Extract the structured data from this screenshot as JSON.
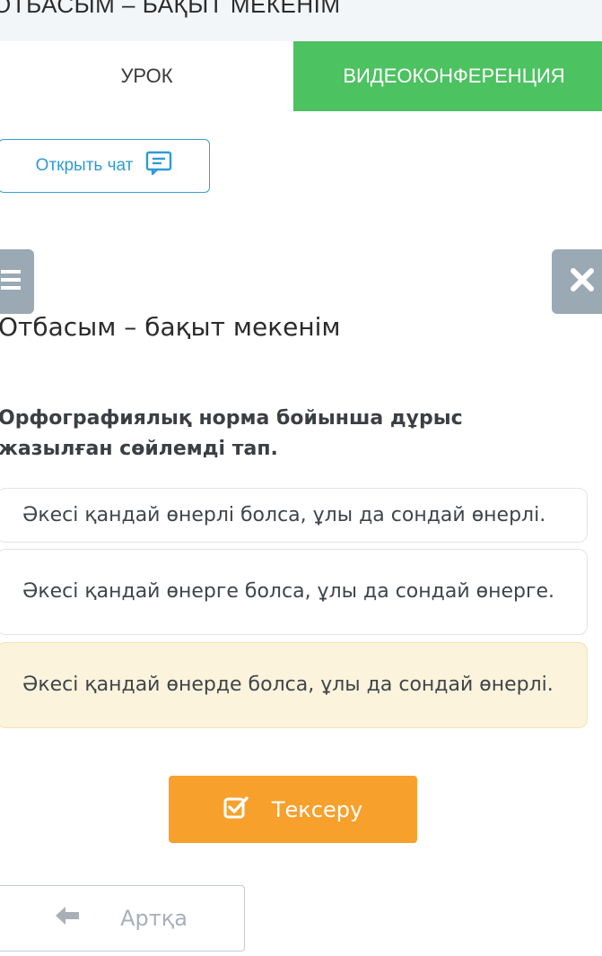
{
  "page_heading": "ОТБАСЫМ – БАҚЫТ МЕКЕНІМ",
  "tabs": [
    {
      "label": "УРОК"
    },
    {
      "label": "ВИДЕОКОНФЕРЕНЦИЯ"
    }
  ],
  "chat_button": {
    "label": "Открыть чат",
    "icon": "chat-icon"
  },
  "lesson_title": "Отбасым – бақыт мекенім",
  "question": "Орфографиялық норма бойынша дұрыс жазылған сөйлемді тап.",
  "options": [
    {
      "text": "Әкесі қандай өнерлі болса, ұлы да сондай өнерлі."
    },
    {
      "text": "Әкесі қандай өнерге болса, ұлы да сондай өнерге."
    },
    {
      "text": "Әкесі қандай өнерде болса, ұлы да сондай өнерлі.",
      "selected": true
    }
  ],
  "check_button": {
    "label": "Тексеру",
    "icon": "checkbox-check-icon"
  },
  "back_button": {
    "label": "Артқа",
    "icon": "arrow-left-icon"
  },
  "colors": {
    "tab_active_green": "#4cc261",
    "chat_blue": "#2f9bd4",
    "check_orange": "#f7a12c",
    "selected_option_bg": "#fcf3dc",
    "side_button_gray": "#9aa9b4"
  }
}
